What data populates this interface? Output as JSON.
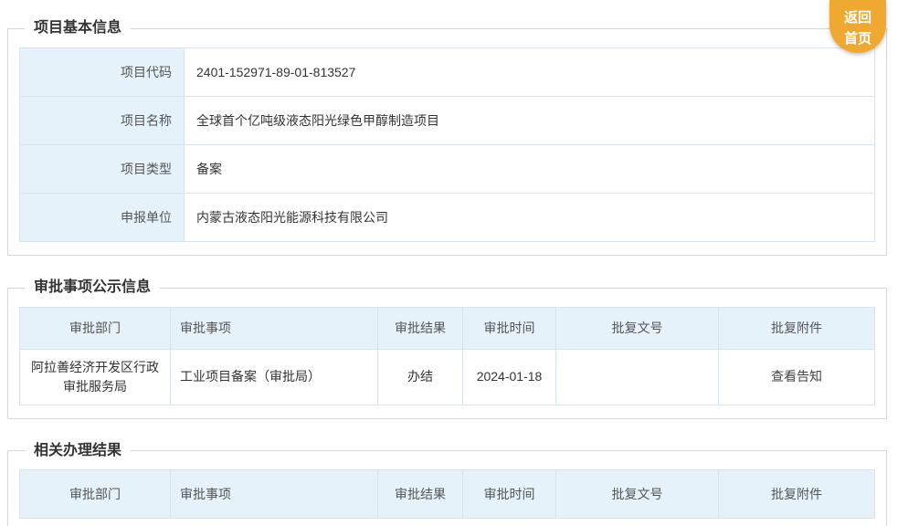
{
  "page": {
    "back_home_label": "返回首页"
  },
  "sections": {
    "basic_info": {
      "title": "项目基本信息",
      "rows": [
        {
          "label": "项目代码",
          "value": "2401-152971-89-01-813527"
        },
        {
          "label": "项目名称",
          "value": "全球首个亿吨级液态阳光绿色甲醇制造项目"
        },
        {
          "label": "项目类型",
          "value": "备案"
        },
        {
          "label": "申报单位",
          "value": "内蒙古液态阳光能源科技有限公司"
        }
      ]
    },
    "approval_info": {
      "title": "审批事项公示信息",
      "headers": [
        "审批部门",
        "审批事项",
        "审批结果",
        "审批时间",
        "批复文号",
        "批复附件"
      ],
      "rows": [
        {
          "department": "阿拉善经济开发区行政审批服务局",
          "item": "工业项目备案（审批局）",
          "result": "办结",
          "time": "2024-01-18",
          "doc_no": "",
          "attachment": "查看告知"
        }
      ]
    },
    "related_results": {
      "title": "相关办理结果",
      "headers": [
        "审批部门",
        "审批事项",
        "审批结果",
        "审批时间",
        "批复文号",
        "批复附件"
      ]
    }
  },
  "colors": {
    "header_cell_bg": "#e5f2fa",
    "cell_border": "#d7e4ee",
    "section_border": "#d6d6d6",
    "accent_button": "#efa930"
  }
}
